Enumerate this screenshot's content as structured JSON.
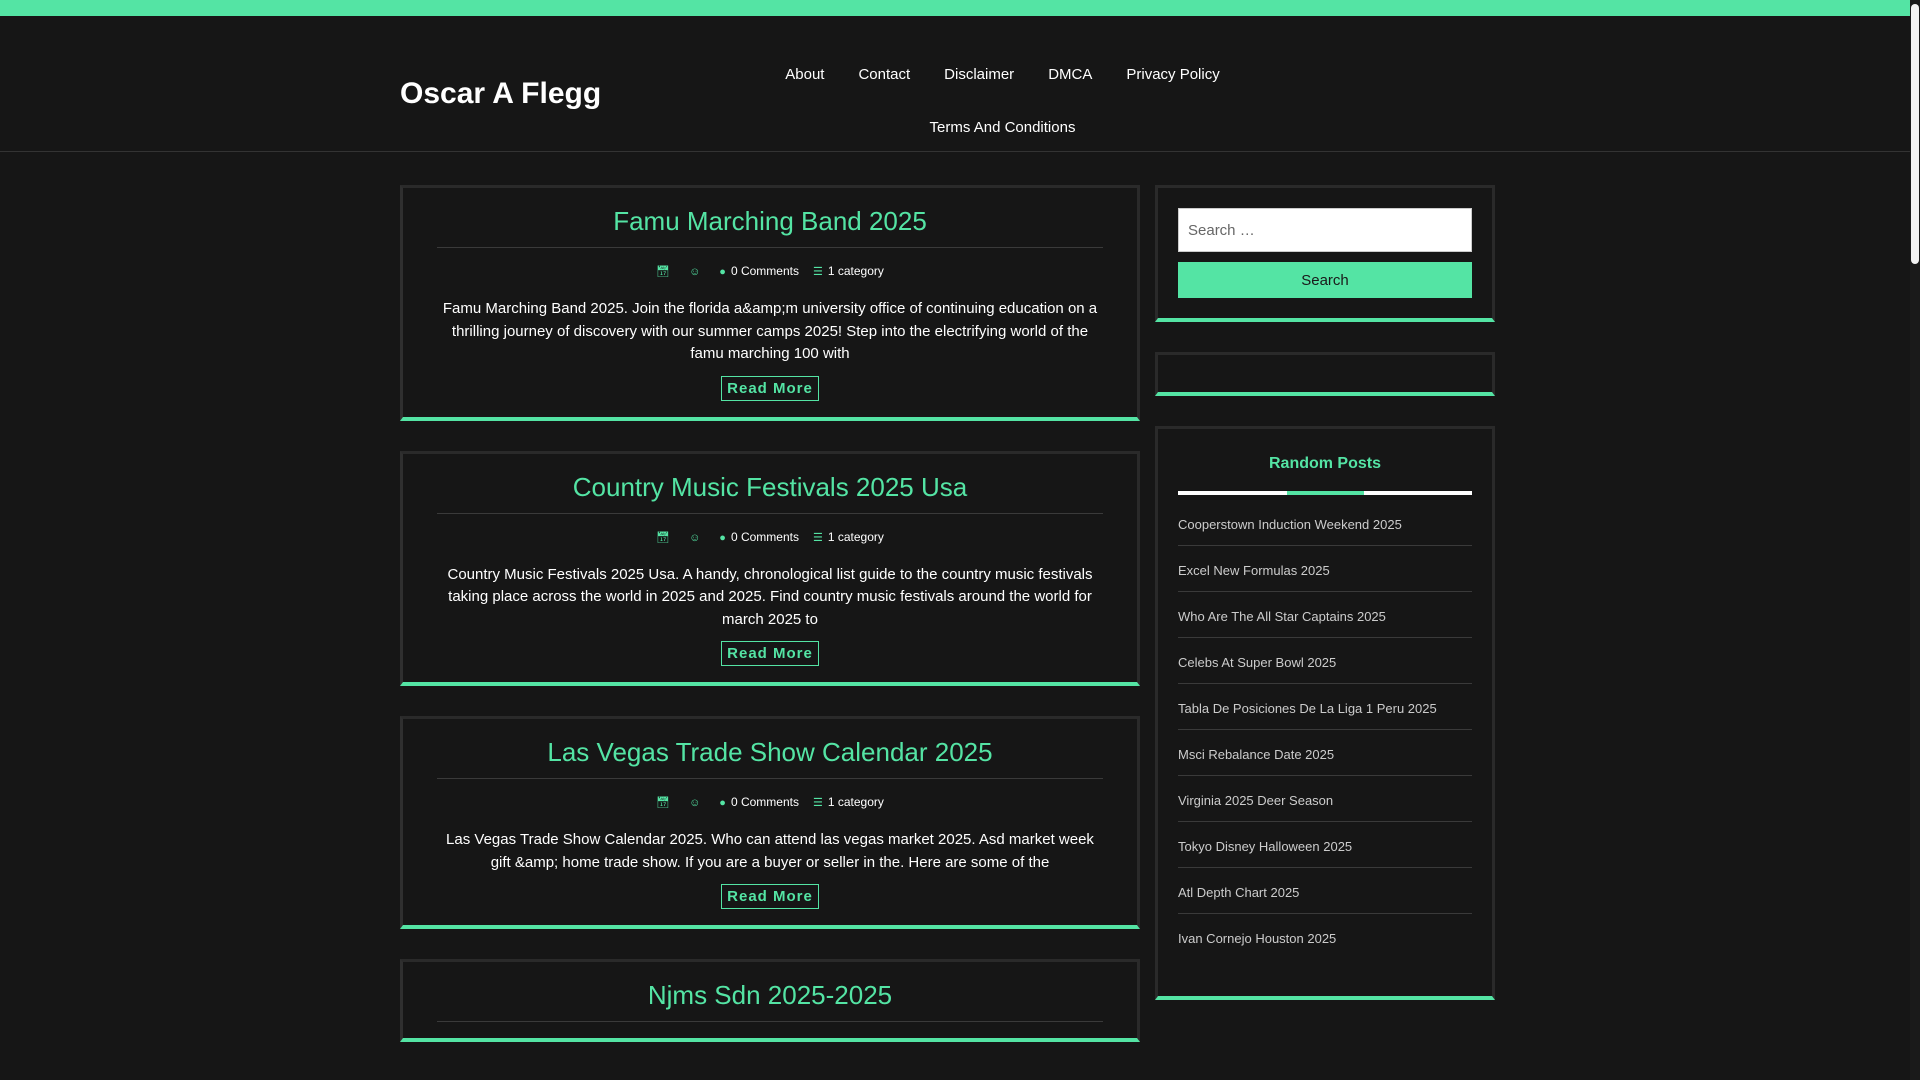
{
  "site": {
    "title": "Oscar A Flegg"
  },
  "nav": [
    "About",
    "Contact",
    "Disclaimer",
    "DMCA",
    "Privacy Policy",
    "Terms And Conditions"
  ],
  "posts": [
    {
      "title": "Famu Marching Band 2025",
      "comments": "0 Comments",
      "category": "1 category",
      "excerpt": "Famu Marching Band 2025. Join the florida a&amp;m university office of continuing education on a thrilling journey of discovery with our summer camps 2025! Step into the electrifying world of the famu marching 100 with",
      "read_more": "Read More"
    },
    {
      "title": "Country Music Festivals 2025 Usa",
      "comments": "0 Comments",
      "category": "1 category",
      "excerpt": "Country Music Festivals 2025 Usa. A handy, chronological list guide to the country music festivals taking place across the world in 2025 and 2025. Find country music festivals around the world for march 2025 to",
      "read_more": "Read More"
    },
    {
      "title": "Las Vegas Trade Show Calendar 2025",
      "comments": "0 Comments",
      "category": "1 category",
      "excerpt": "Las Vegas Trade Show Calendar 2025. Who can attend las vegas market 2025. Asd market week gift &amp; home trade show. If you are a buyer or seller in the. Here are some of the",
      "read_more": "Read More"
    },
    {
      "title": "Njms Sdn 2025-2025"
    }
  ],
  "sidebar": {
    "search_placeholder": "Search …",
    "search_button": "Search",
    "random_title": "Random Posts",
    "random_posts": [
      "Cooperstown Induction Weekend 2025",
      "Excel New Formulas 2025",
      "Who Are The All Star Captains 2025",
      "Celebs At Super Bowl 2025",
      "Tabla De Posiciones De La Liga 1 Peru 2025",
      "Msci Rebalance Date 2025",
      "Virginia 2025 Deer Season",
      "Tokyo Disney Halloween 2025",
      "Atl Depth Chart 2025",
      "Ivan Cornejo Houston 2025"
    ]
  },
  "icons": {
    "calendar": "calendar-icon",
    "user": "user-icon",
    "comments": "comments-icon",
    "category": "list-icon"
  },
  "colors": {
    "accent": "#54e4a4",
    "background": "#161616"
  }
}
